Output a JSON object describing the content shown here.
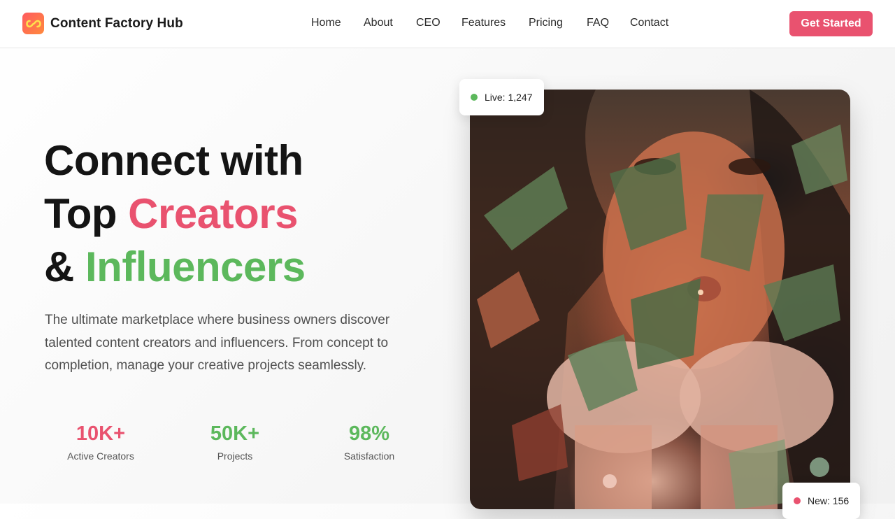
{
  "brand": {
    "name": "Content Factory Hub",
    "logo_icon": "infinity-icon",
    "logo_colors": [
      "#ff5a5f",
      "#ff8a3d"
    ]
  },
  "nav": {
    "links": [
      "Home",
      "About",
      "CEO",
      "Features",
      "Pricing",
      "FAQ",
      "Contact"
    ],
    "cta_label": "Get Started"
  },
  "hero": {
    "headline": {
      "line1": "Connect with",
      "line2_plain": "Top ",
      "line2_accent": "Creators",
      "line3_plain": "& ",
      "line3_accent": "Influencers"
    },
    "subtext": "The ultimate marketplace where business owners discover talented content creators and influencers. From concept to completion, manage your creative projects seamlessly.",
    "stats": [
      {
        "value": "10K+",
        "label": "Active Creators",
        "color": "#e9526f"
      },
      {
        "value": "50K+",
        "label": "Projects",
        "color": "#5cb85c"
      },
      {
        "value": "98%",
        "label": "Satisfaction",
        "color": "#5cb85c"
      }
    ]
  },
  "badges": {
    "live": {
      "text": "Live: 1,247",
      "dot_color": "#5cb85c"
    },
    "new": {
      "text": "New: 156",
      "dot_color": "#e9526f"
    }
  },
  "colors": {
    "accent_pink": "#e9526f",
    "accent_green": "#5cb85c",
    "text_dark": "#141414"
  }
}
